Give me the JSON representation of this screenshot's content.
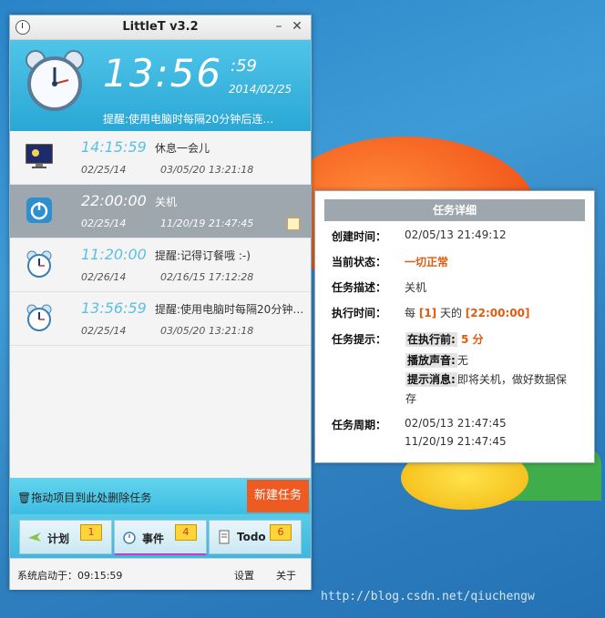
{
  "window": {
    "title": "LittleT v3.2"
  },
  "clock": {
    "time": "13:56",
    "seconds": ":59",
    "date": "2014/02/25",
    "tip": "提醒:使用电脑时每隔20分钟后连…"
  },
  "tasks": [
    {
      "time": "14:15:59",
      "name": "休息一会儿",
      "date1": "02/25/14",
      "date2": "03/05/20 13:21:18",
      "icon": "monitor-icon"
    },
    {
      "time": "22:00:00",
      "name": "关机",
      "date1": "02/25/14",
      "date2": "11/20/19 21:47:45",
      "icon": "power-icon",
      "selected": true
    },
    {
      "time": "11:20:00",
      "name": "提醒:记得订餐哦 :-)",
      "date1": "02/26/14",
      "date2": "02/16/15 17:12:28",
      "icon": "alarm-clock-icon"
    },
    {
      "time": "13:56:59",
      "name": "提醒:使用电脑时每隔20分钟…",
      "date1": "02/25/14",
      "date2": "03/05/20 13:21:18",
      "icon": "alarm-clock-icon"
    }
  ],
  "dropbar": {
    "label": "拖动项目到此处删除任务",
    "new_button": "新建任务"
  },
  "tabs": [
    {
      "label": "计划",
      "badge": "1"
    },
    {
      "label": "事件",
      "badge": "4"
    },
    {
      "label": "Todo",
      "badge": "6"
    }
  ],
  "status": {
    "started": "系统启动于：09:15:59",
    "settings": "设置",
    "about": "关于"
  },
  "detail": {
    "title": "任务详细",
    "created_label": "创建时间：",
    "created": "02/05/13 21:49:12",
    "state_label": "当前状态：",
    "state": "一切正常",
    "desc_label": "任务描述：",
    "desc": "关机",
    "exec_label": "执行时间：",
    "exec_pre": "每 ",
    "exec_n": "[1]",
    "exec_mid": " 天的 ",
    "exec_time": "[22:00:00]",
    "hint_label": "任务提示：",
    "before_k": "在执行前:",
    "before_v": " 5 分",
    "sound_k": "播放声音:",
    "sound_v": "无",
    "msg_k": "提示消息:",
    "msg_v": "即将关机，做好数据保",
    "msg_v2": "存",
    "period_label": "任务周期：",
    "period1": "02/05/13 21:47:45",
    "period2": "11/20/19 21:47:45"
  },
  "watermark": "http://blog.csdn.net/qiuchengw",
  "colors": {
    "accent": "#2aa7d6",
    "selected_row": "#9ea6ae",
    "new_button": "#ee5b22"
  }
}
